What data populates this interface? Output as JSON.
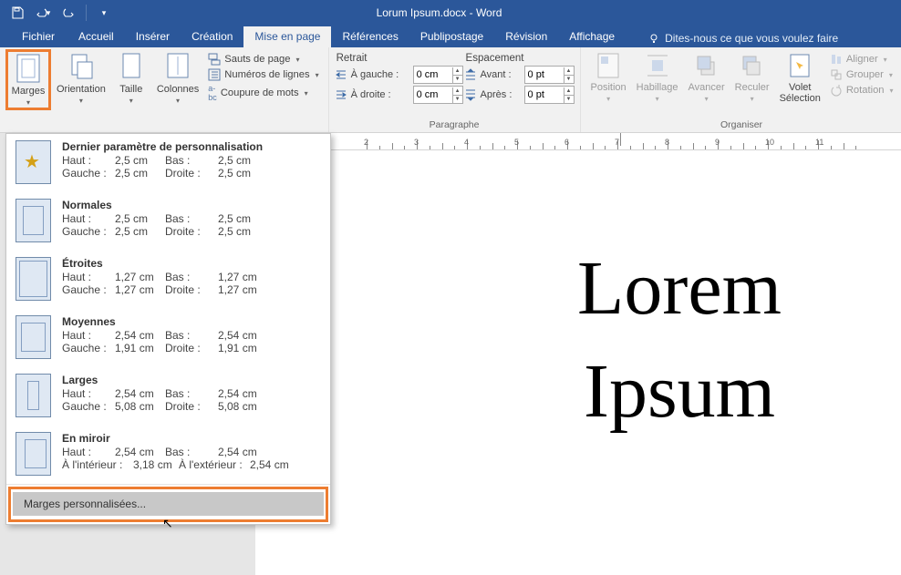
{
  "title": "Lorum Ipsum.docx  -  Word",
  "tabs": {
    "file": "Fichier",
    "home": "Accueil",
    "insert": "Insérer",
    "design": "Création",
    "layout": "Mise en page",
    "references": "Références",
    "mailings": "Publipostage",
    "review": "Révision",
    "view": "Affichage"
  },
  "tellme": "Dites-nous ce que vous voulez faire",
  "ribbon": {
    "margins": "Marges",
    "orientation": "Orientation",
    "size": "Taille",
    "columns": "Colonnes",
    "breaks": "Sauts de page",
    "line_numbers": "Numéros de lignes",
    "hyphenation": "Coupure de mots",
    "retrait_label": "Retrait",
    "espacement_label": "Espacement",
    "a_gauche": "À gauche :",
    "a_droite": "À droite :",
    "avant": "Avant :",
    "apres": "Après :",
    "para_group": "Paragraphe",
    "position": "Position",
    "habillage": "Habillage",
    "avancer": "Avancer",
    "reculer": "Reculer",
    "volet_sel": "Volet\nSélection",
    "aligner": "Aligner",
    "grouper": "Grouper",
    "rotation": "Rotation",
    "organiser_group": "Organiser",
    "retrait_gauche_val": "0 cm",
    "retrait_droite_val": "0 cm",
    "avant_val": "0 pt",
    "apres_val": "0 pt"
  },
  "presets": [
    {
      "name": "Dernier paramètre de personnalisation",
      "haut": "2,5 cm",
      "bas": "2,5 cm",
      "gauche": "2,5 cm",
      "droite": "2,5 cm",
      "thumb": "star",
      "label_l": "Gauche :",
      "label_r": "Droite :"
    },
    {
      "name": "Normales",
      "haut": "2,5 cm",
      "bas": "2,5 cm",
      "gauche": "2,5 cm",
      "droite": "2,5 cm",
      "thumb": "normal",
      "label_l": "Gauche :",
      "label_r": "Droite :"
    },
    {
      "name": "Étroites",
      "haut": "1,27 cm",
      "bas": "1,27 cm",
      "gauche": "1,27 cm",
      "droite": "1,27 cm",
      "thumb": "narrow",
      "label_l": "Gauche :",
      "label_r": "Droite :"
    },
    {
      "name": "Moyennes",
      "haut": "2,54 cm",
      "bas": "2,54 cm",
      "gauche": "1,91 cm",
      "droite": "1,91 cm",
      "thumb": "moderate",
      "label_l": "Gauche :",
      "label_r": "Droite :"
    },
    {
      "name": "Larges",
      "haut": "2,54 cm",
      "bas": "2,54 cm",
      "gauche": "5,08 cm",
      "droite": "5,08 cm",
      "thumb": "wide",
      "label_l": "Gauche :",
      "label_r": "Droite :"
    },
    {
      "name": "En miroir",
      "haut": "2,54 cm",
      "bas": "2,54 cm",
      "gauche": "3,18 cm",
      "droite": "2,54 cm",
      "thumb": "mirror",
      "label_l": "À l'intérieur :",
      "label_r": "À l'extérieur :"
    }
  ],
  "custom_margins": "Marges personnalisées...",
  "labels": {
    "haut": "Haut :",
    "bas": "Bas :"
  },
  "doc": {
    "line1": "Lorem",
    "line2": "Ipsum"
  },
  "ruler_numbers": [
    2,
    3,
    4,
    5,
    6,
    7,
    8,
    9,
    10,
    11
  ]
}
